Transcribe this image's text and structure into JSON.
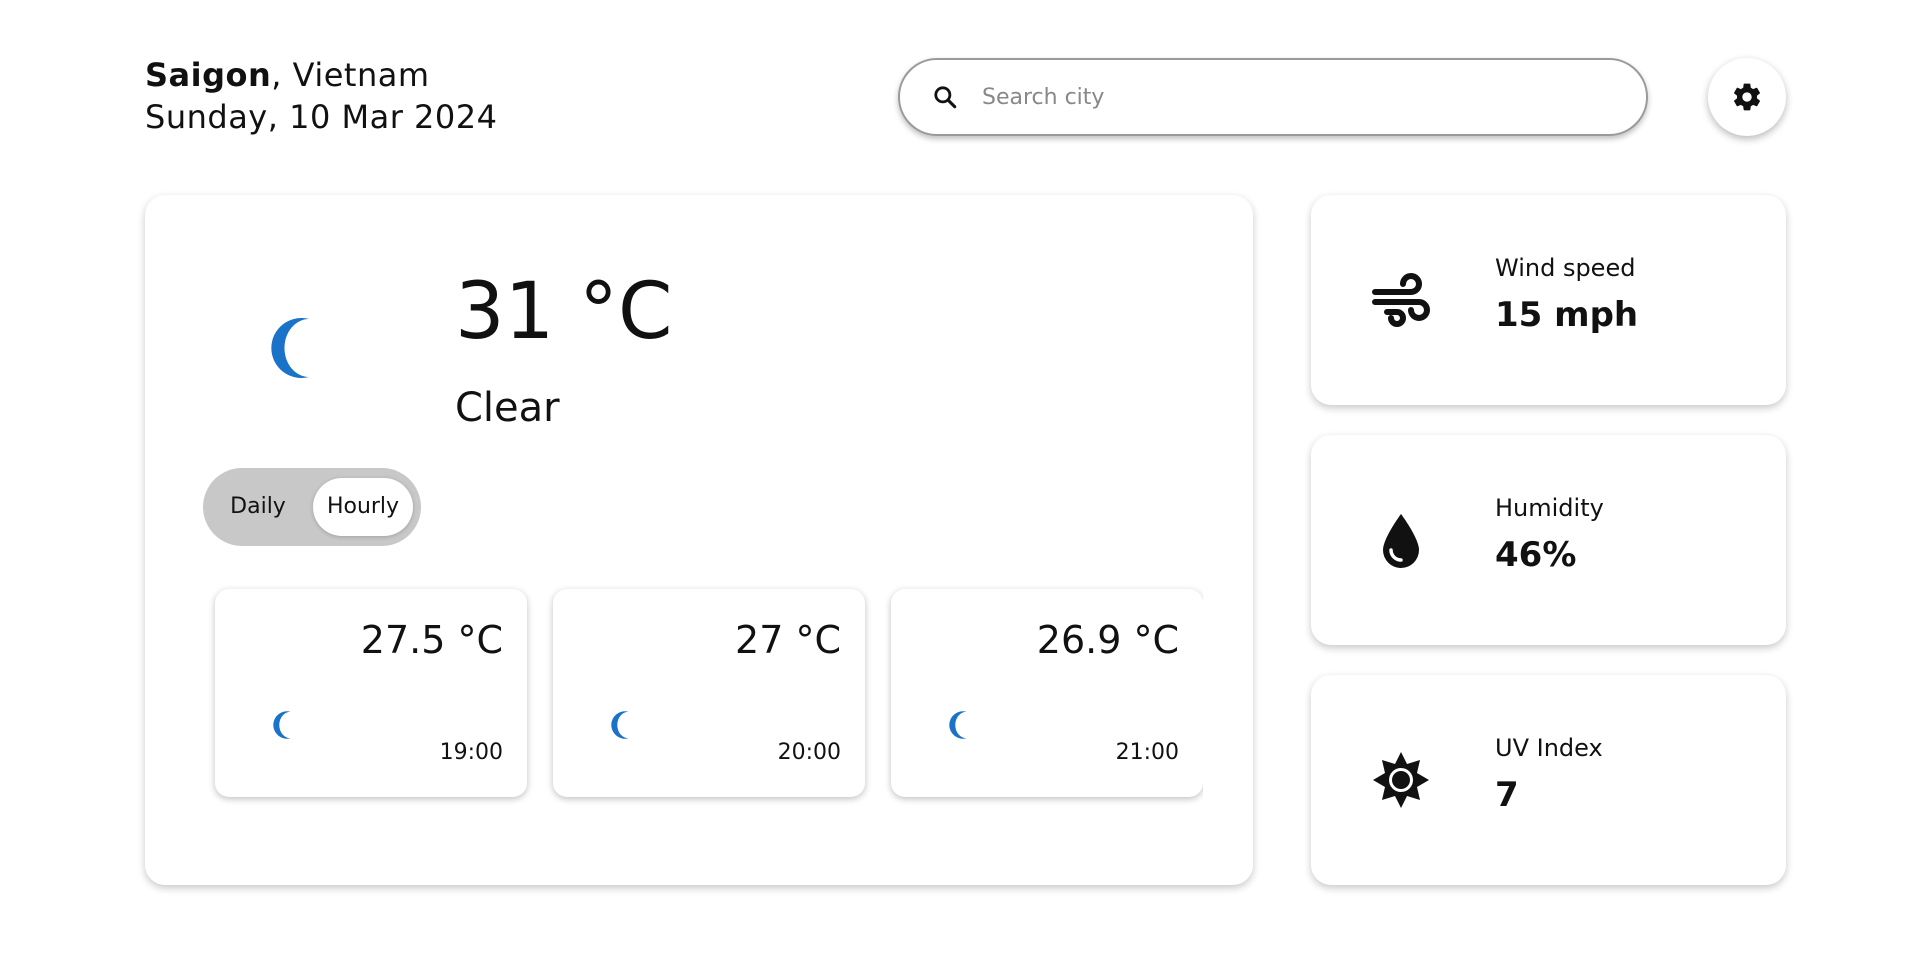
{
  "location": {
    "city": "Saigon",
    "country": ", Vietnam",
    "date": "Sunday, 10 Mar 2024"
  },
  "search": {
    "placeholder": "Search city",
    "icon": "search-icon"
  },
  "settings": {
    "icon": "gear-icon"
  },
  "current": {
    "temperature": "31 °C",
    "condition": "Clear",
    "icon": "crescent-moon-icon",
    "icon_color": "#1a73c8"
  },
  "toggle": {
    "options": [
      "Daily",
      "Hourly"
    ],
    "selected": "Hourly"
  },
  "hourly": [
    {
      "temp": "27.5 °C",
      "time": "19:00",
      "icon": "crescent-moon-icon"
    },
    {
      "temp": "27 °C",
      "time": "20:00",
      "icon": "crescent-moon-icon"
    },
    {
      "temp": "26.9 °C",
      "time": "21:00",
      "icon": "crescent-moon-icon"
    }
  ],
  "stats": [
    {
      "label": "Wind speed",
      "value": "15 mph",
      "icon": "wind-icon"
    },
    {
      "label": "Humidity",
      "value": "46%",
      "icon": "water-drop-icon"
    },
    {
      "label": "UV Index",
      "value": "7",
      "icon": "sun-icon"
    }
  ]
}
